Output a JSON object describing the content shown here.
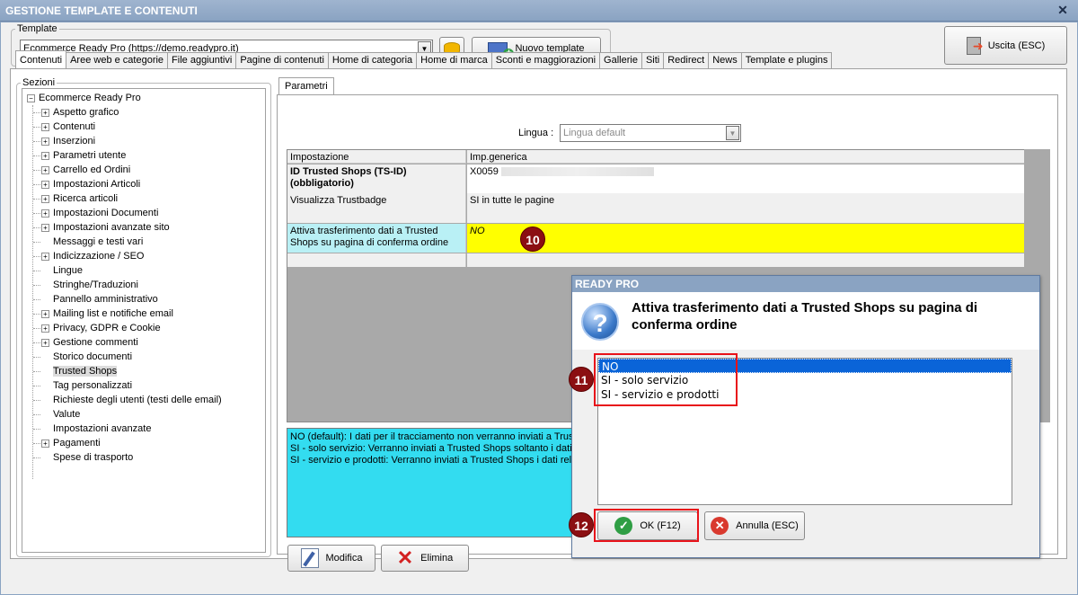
{
  "window": {
    "title": "GESTIONE TEMPLATE E CONTENUTI"
  },
  "template": {
    "group_label": "Template",
    "selected": "Ecommerce Ready Pro (https://demo.readypro.it)",
    "new_button": "Nuovo template"
  },
  "exit_button": "Uscita (ESC)",
  "tabs": [
    "Contenuti",
    "Aree web e categorie",
    "File aggiuntivi",
    "Pagine di contenuti",
    "Home di categoria",
    "Home di marca",
    "Sconti e maggiorazioni",
    "Gallerie",
    "Siti",
    "Redirect",
    "News",
    "Template e plugins"
  ],
  "sections": {
    "label": "Sezioni",
    "root": "Ecommerce Ready Pro",
    "items": [
      {
        "label": "Aspetto grafico",
        "expandable": true
      },
      {
        "label": "Contenuti",
        "expandable": true
      },
      {
        "label": "Inserzioni",
        "expandable": true
      },
      {
        "label": "Parametri utente",
        "expandable": true
      },
      {
        "label": "Carrello ed Ordini",
        "expandable": true
      },
      {
        "label": "Impostazioni Articoli",
        "expandable": true
      },
      {
        "label": "Ricerca articoli",
        "expandable": true
      },
      {
        "label": "Impostazioni Documenti",
        "expandable": true
      },
      {
        "label": "Impostazioni avanzate sito",
        "expandable": true
      },
      {
        "label": "Messaggi e testi vari",
        "expandable": false
      },
      {
        "label": "Indicizzazione / SEO",
        "expandable": true
      },
      {
        "label": "Lingue",
        "expandable": false
      },
      {
        "label": "Stringhe/Traduzioni",
        "expandable": false
      },
      {
        "label": "Pannello amministrativo",
        "expandable": false
      },
      {
        "label": "Mailing list e notifiche email",
        "expandable": true
      },
      {
        "label": "Privacy, GDPR e Cookie",
        "expandable": true
      },
      {
        "label": "Gestione commenti",
        "expandable": true
      },
      {
        "label": "Storico documenti",
        "expandable": false
      },
      {
        "label": "Trusted Shops",
        "expandable": false,
        "selected": true
      },
      {
        "label": "Tag personalizzati",
        "expandable": false
      },
      {
        "label": "Richieste degli utenti (testi delle email)",
        "expandable": false
      },
      {
        "label": "Valute",
        "expandable": false
      },
      {
        "label": "Impostazioni avanzate",
        "expandable": false
      },
      {
        "label": "Pagamenti",
        "expandable": true
      },
      {
        "label": "Spese di trasporto",
        "expandable": false
      }
    ]
  },
  "params": {
    "tab": "Parametri",
    "lingua_label": "Lingua :",
    "lingua_value": "Lingua default",
    "col_setting": "Impostazione",
    "col_value": "Imp.generica",
    "rows": [
      {
        "setting": "ID Trusted Shops (TS-ID) (obbligatorio)",
        "value": "X0059"
      },
      {
        "setting": "Visualizza Trustbadge",
        "value": "SI in tutte le pagine"
      },
      {
        "setting": "Attiva trasferimento dati a Trusted Shops su pagina di conferma ordine",
        "value": "NO"
      }
    ],
    "description": [
      "NO (default): I dati per il tracciamento non verranno inviati a Trust",
      "SI - solo servizio: Verranno inviati a Trusted Shops soltanto i dati r",
      "SI - servizio e prodotti: Verranno inviati a Trusted Shops i dati rela"
    ],
    "edit_button": "Modifica",
    "delete_button": "Elimina"
  },
  "dialog": {
    "title": "READY PRO",
    "message": "Attiva trasferimento dati a Trusted Shops su pagina di conferma ordine",
    "options": [
      "NO",
      "SI - solo servizio",
      "SI - servizio e prodotti"
    ],
    "selected_index": 0,
    "ok_button": "OK (F12)",
    "cancel_button": "Annulla (ESC)"
  },
  "markers": {
    "m10": "10",
    "m11": "11",
    "m12": "12"
  },
  "colors": {
    "highlight_row": "#ffff00",
    "description_bg": "#33dcf0",
    "marker": "#8b0f12",
    "red_box": "#e8121a"
  }
}
